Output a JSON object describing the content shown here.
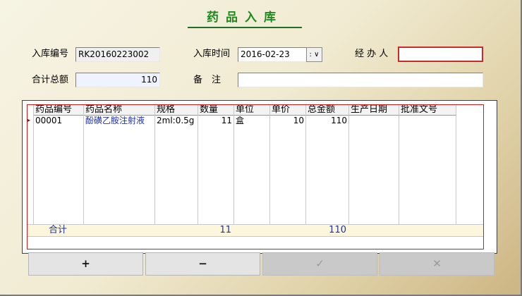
{
  "title": "药品入库",
  "form": {
    "in_no_label": "入库编号",
    "in_no_value": "RK20160223002",
    "in_time_label": "入库时间",
    "in_time_value": "2016-02-23",
    "dropdown_value": ":",
    "handler_label": "经 办 人",
    "handler_value": "",
    "total_label": "合计总额",
    "total_value": "110",
    "remark_label": "备　注",
    "remark_value": ""
  },
  "grid": {
    "columns": [
      "药品编号",
      "药品名称",
      "规格",
      "数量",
      "单位",
      "单价",
      "总金额",
      "生产日期",
      "批准文号"
    ],
    "rows": [
      {
        "indicator": "▸",
        "code": "00001",
        "name": "酚磺乙胺注射液",
        "spec": "2ml:0.5g",
        "qty": "11",
        "unit": "盒",
        "price": "10",
        "amount": "110",
        "prod_date": "",
        "approval": ""
      }
    ],
    "summary": {
      "label": "合计",
      "qty": "11",
      "amount": "110"
    }
  },
  "buttons": {
    "add": "+",
    "remove": "−",
    "confirm": "✓",
    "cancel": "✕"
  },
  "colors": {
    "title": "#1d8a1d",
    "required_border": "#c92b2b",
    "grid_outline": "#d21b1b",
    "summary_text": "#2030a0"
  }
}
